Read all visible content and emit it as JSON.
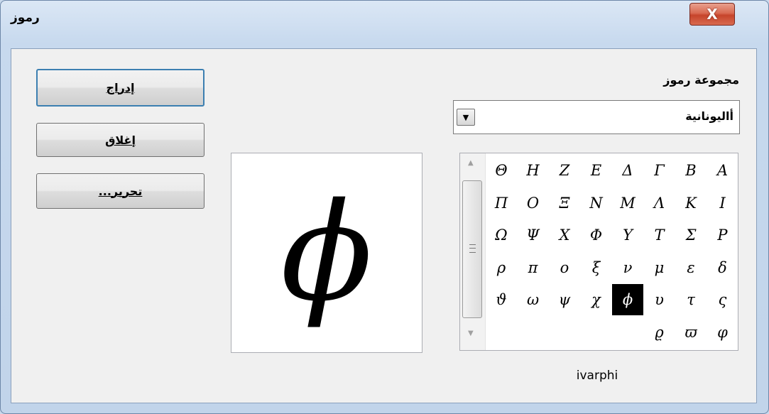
{
  "window": {
    "title": "رموز",
    "close_glyph": "X"
  },
  "buttons": {
    "insert": "إدراج",
    "close": "إغلاق",
    "edit": "تحرير..."
  },
  "symbol_set": {
    "label": "مجموعة رموز",
    "value": "أاليونانية",
    "dropdown_icon": "▼"
  },
  "preview": {
    "symbol": "ϕ"
  },
  "symbol_grid": {
    "rows": [
      [
        "A",
        "B",
        "Γ",
        "Δ",
        "E",
        "Z",
        "H",
        "Θ"
      ],
      [
        "I",
        "K",
        "Λ",
        "M",
        "N",
        "Ξ",
        "O",
        "Π"
      ],
      [
        "P",
        "Σ",
        "T",
        "Υ",
        "Φ",
        "X",
        "Ψ",
        "Ω"
      ],
      [
        "δ",
        "ε",
        "μ",
        "ν",
        "ξ",
        "ο",
        "π",
        "ρ"
      ],
      [
        "ς",
        "τ",
        "υ",
        "ϕ",
        "χ",
        "ψ",
        "ω",
        "ϑ"
      ],
      [
        "φ",
        "ϖ",
        "ϱ"
      ]
    ],
    "selected": "ϕ",
    "scroll_up_icon": "▲",
    "scroll_down_icon": "▼"
  },
  "selected_symbol_name": "ivarphi"
}
